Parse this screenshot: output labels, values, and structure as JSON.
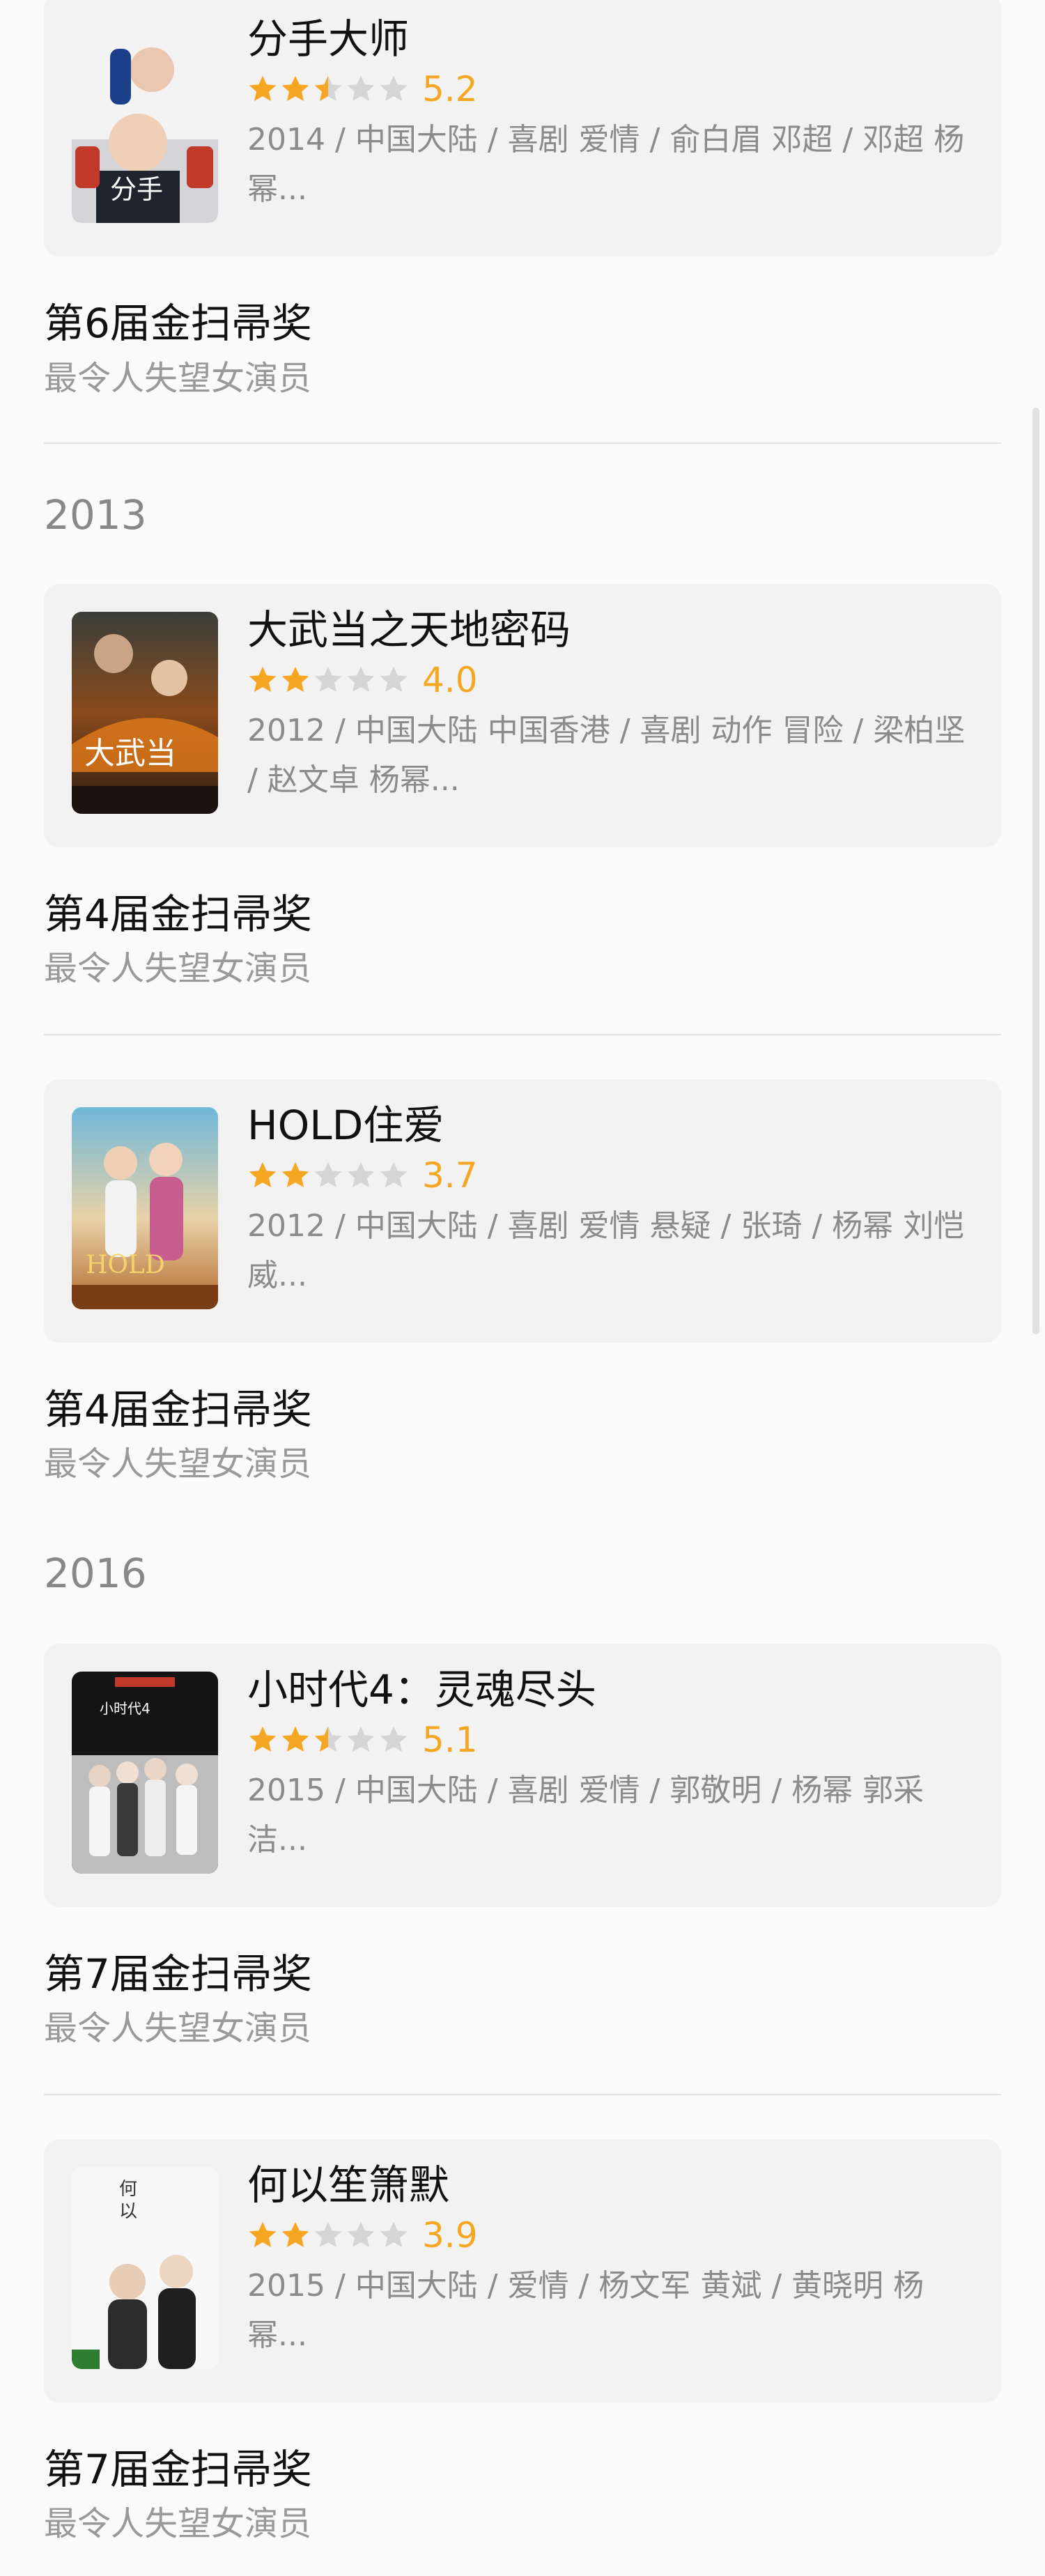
{
  "colors": {
    "star_filled": "#f5a623",
    "star_empty": "#d5d5d5",
    "score": "#f5a623"
  },
  "entries": [
    {
      "title": "分手大师",
      "score": "5.2",
      "rating": 2.5,
      "meta": "2014 / 中国大陆 / 喜剧 爱情 / 俞白眉 邓超 / 邓超 杨幂...",
      "award": "第6届金扫帚奖",
      "category": "最令人失望女演员",
      "poster_icon": "movie-poster"
    },
    {
      "title": "大武当之天地密码",
      "score": "4.0",
      "rating": 2,
      "meta": "2012 / 中国大陆 中国香港 / 喜剧 动作 冒险 / 梁柏坚 / 赵文卓 杨幂...",
      "award": "第4届金扫帚奖",
      "category": "最令人失望女演员",
      "poster_icon": "movie-poster"
    },
    {
      "title": "HOLD住爱",
      "score": "3.7",
      "rating": 2,
      "meta": "2012 / 中国大陆 / 喜剧 爱情 悬疑 / 张琦 / 杨幂 刘恺威...",
      "award": "第4届金扫帚奖",
      "category": "最令人失望女演员",
      "poster_icon": "movie-poster"
    },
    {
      "title": "小时代4：灵魂尽头",
      "score": "5.1",
      "rating": 2.5,
      "meta": "2015 / 中国大陆 / 喜剧 爱情 / 郭敬明 / 杨幂 郭采洁...",
      "award": "第7届金扫帚奖",
      "category": "最令人失望女演员",
      "poster_icon": "movie-poster"
    },
    {
      "title": "何以笙箫默",
      "score": "3.9",
      "rating": 2,
      "meta": "2015 / 中国大陆 / 爱情 / 杨文军 黄斌 / 黄晓明 杨幂...",
      "award": "第7届金扫帚奖",
      "category": "最令人失望女演员",
      "poster_icon": "movie-poster"
    }
  ],
  "years": [
    "2013",
    "2016"
  ]
}
